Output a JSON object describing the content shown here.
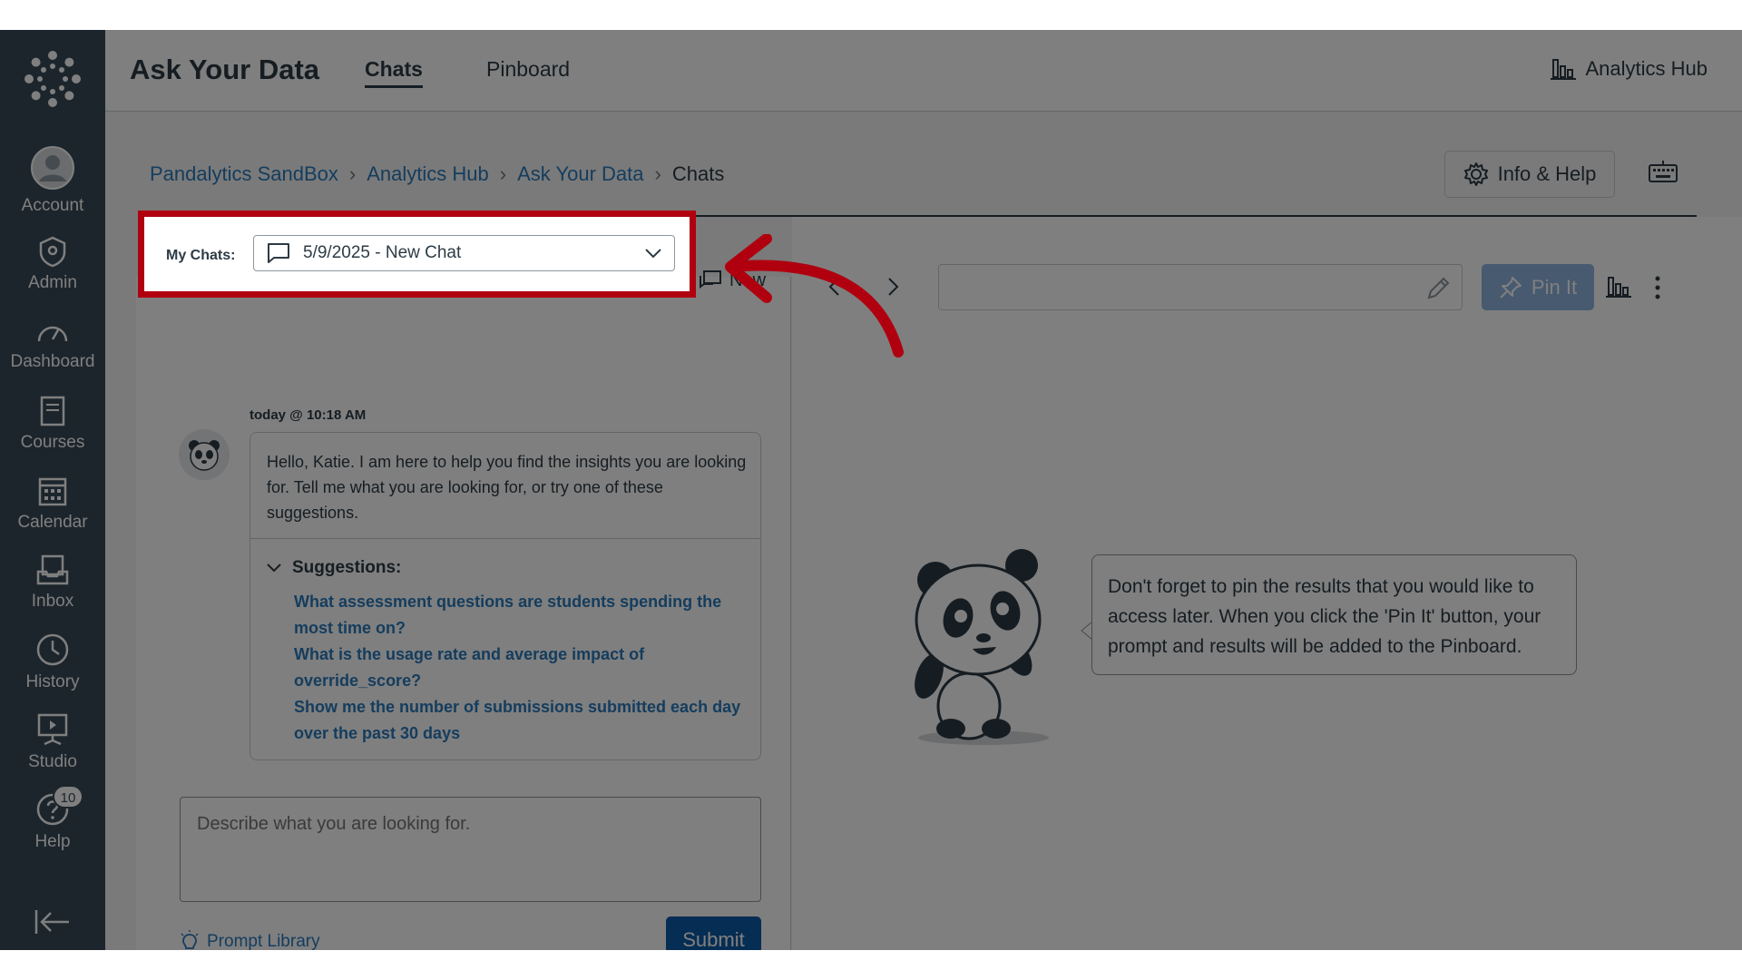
{
  "nav": {
    "items": [
      {
        "label": "Account",
        "icon": "account-icon"
      },
      {
        "label": "Admin",
        "icon": "admin-icon"
      },
      {
        "label": "Dashboard",
        "icon": "dashboard-icon"
      },
      {
        "label": "Courses",
        "icon": "courses-icon"
      },
      {
        "label": "Calendar",
        "icon": "calendar-icon"
      },
      {
        "label": "Inbox",
        "icon": "inbox-icon"
      },
      {
        "label": "History",
        "icon": "history-icon"
      },
      {
        "label": "Studio",
        "icon": "studio-icon"
      },
      {
        "label": "Help",
        "icon": "help-icon"
      }
    ],
    "help_badge": "10"
  },
  "header": {
    "title": "Ask Your Data",
    "tabs": [
      {
        "label": "Chats"
      },
      {
        "label": "Pinboard"
      }
    ],
    "hub_link": "Analytics Hub"
  },
  "breadcrumb": [
    "Pandalytics SandBox",
    "Analytics Hub",
    "Ask Your Data",
    "Chats"
  ],
  "info_help": "Info & Help",
  "my_chats": {
    "label": "My Chats:",
    "selected": "5/9/2025 - New Chat",
    "new_label": "New"
  },
  "conversation": {
    "timestamp": "today @ 10:18 AM",
    "greeting": "Hello, Katie. I am here to help you find the insights you are looking for. Tell me what you are looking for, or try one of these suggestions.",
    "suggestions_title": "Suggestions:",
    "suggestions": [
      "What assessment questions are students spending the most time on?",
      "What is the usage rate and average impact of override_score?",
      "Show me the number of submissions submitted each day over the past 30 days"
    ]
  },
  "prompt": {
    "placeholder": "Describe what you are looking for.",
    "library": "Prompt Library",
    "submit": "Submit"
  },
  "results": {
    "pin_label": "Pin It",
    "tip": "Don't forget to pin the results that you would like to access later. When you click the 'Pin It' button, your prompt and results will be added to the Pinboard."
  },
  "colors": {
    "nav_bg": "#394b58",
    "link": "#2b7abc",
    "submit": "#0d5aa7",
    "highlight": "#b0000f"
  }
}
